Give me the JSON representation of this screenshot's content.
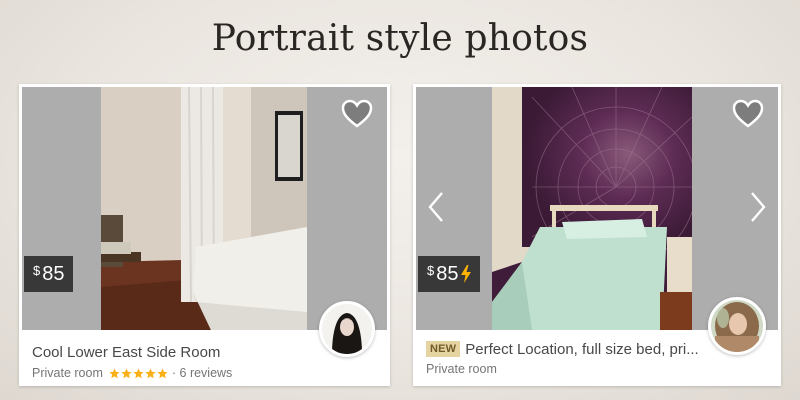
{
  "headline": "Portrait style photos",
  "listings": [
    {
      "price_currency": "$",
      "price_amount": "85",
      "instant_book": false,
      "is_new": false,
      "title": "Cool Lower East Side Room",
      "room_type": "Private room",
      "separator": "·",
      "rating_stars": 5,
      "reviews": "6 reviews",
      "favorite_icon": "heart-icon",
      "has_carousel_arrows": false
    },
    {
      "price_currency": "$",
      "price_amount": "85",
      "instant_book": true,
      "is_new": true,
      "new_badge": "NEW",
      "title": "Perfect Location, full size bed, pri...",
      "room_type": "Private room",
      "favorite_icon": "heart-icon",
      "has_carousel_arrows": true
    }
  ],
  "colors": {
    "background": "#ebe6e0",
    "photo_placeholder": "#adadad",
    "price_tag": "#282828",
    "star": "#fcb017",
    "bolt": "#ffb400",
    "new_badge": "#e6d3a2"
  }
}
